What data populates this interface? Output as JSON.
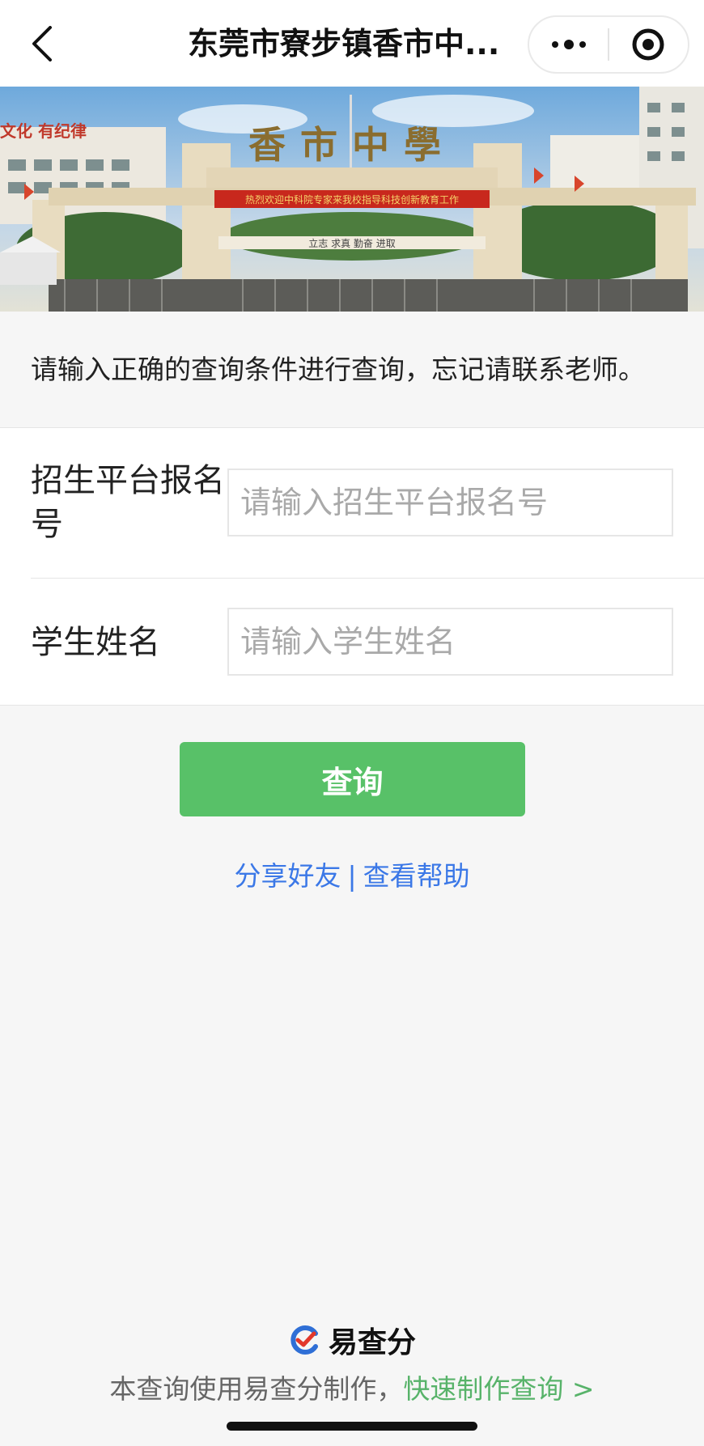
{
  "nav": {
    "title": "东莞市寮步镇香市中...",
    "back_icon": "chevron-left-icon",
    "more_icon": "more-dots-icon",
    "target_icon": "target-circle-icon"
  },
  "banner": {
    "gate_text": "香市中學",
    "left_sign": "文化 有纪律",
    "red_banner": "热烈欢迎中科院专家来我校指导科技创新教育工作",
    "lower_sign": "立志 求真 勤奋 进取"
  },
  "notice": "请输入正确的查询条件进行查询，忘记请联系老师。",
  "form": {
    "fields": [
      {
        "label": "招生平台报名号",
        "placeholder": "请输入招生平台报名号",
        "value": ""
      },
      {
        "label": "学生姓名",
        "placeholder": "请输入学生姓名",
        "value": ""
      }
    ],
    "submit_label": "查询"
  },
  "links": {
    "share": "分享好友",
    "separator": "|",
    "help": "查看帮助"
  },
  "footer": {
    "brand_name": "易查分",
    "brand_icon": "yichafen-logo-icon",
    "text": "本查询使用易查分制作，",
    "link": "快速制作查询 >"
  },
  "colors": {
    "accent_green": "#58c168",
    "link_blue": "#3b78e7",
    "footer_link_green": "#58b36a"
  }
}
